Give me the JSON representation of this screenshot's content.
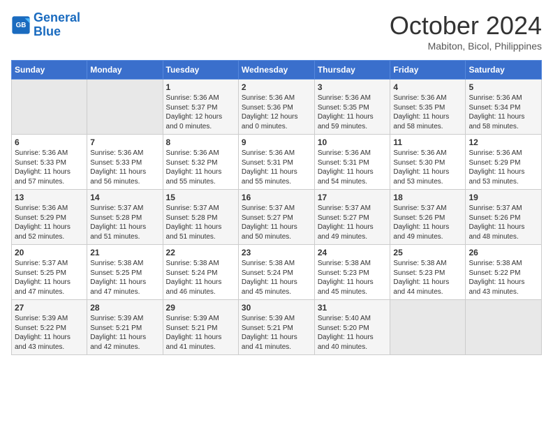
{
  "header": {
    "logo_line1": "General",
    "logo_line2": "Blue",
    "month": "October 2024",
    "location": "Mabiton, Bicol, Philippines"
  },
  "columns": [
    "Sunday",
    "Monday",
    "Tuesday",
    "Wednesday",
    "Thursday",
    "Friday",
    "Saturday"
  ],
  "weeks": [
    [
      {
        "day": "",
        "content": ""
      },
      {
        "day": "",
        "content": ""
      },
      {
        "day": "1",
        "content": "Sunrise: 5:36 AM\nSunset: 5:37 PM\nDaylight: 12 hours\nand 0 minutes."
      },
      {
        "day": "2",
        "content": "Sunrise: 5:36 AM\nSunset: 5:36 PM\nDaylight: 12 hours\nand 0 minutes."
      },
      {
        "day": "3",
        "content": "Sunrise: 5:36 AM\nSunset: 5:35 PM\nDaylight: 11 hours\nand 59 minutes."
      },
      {
        "day": "4",
        "content": "Sunrise: 5:36 AM\nSunset: 5:35 PM\nDaylight: 11 hours\nand 58 minutes."
      },
      {
        "day": "5",
        "content": "Sunrise: 5:36 AM\nSunset: 5:34 PM\nDaylight: 11 hours\nand 58 minutes."
      }
    ],
    [
      {
        "day": "6",
        "content": "Sunrise: 5:36 AM\nSunset: 5:33 PM\nDaylight: 11 hours\nand 57 minutes."
      },
      {
        "day": "7",
        "content": "Sunrise: 5:36 AM\nSunset: 5:33 PM\nDaylight: 11 hours\nand 56 minutes."
      },
      {
        "day": "8",
        "content": "Sunrise: 5:36 AM\nSunset: 5:32 PM\nDaylight: 11 hours\nand 55 minutes."
      },
      {
        "day": "9",
        "content": "Sunrise: 5:36 AM\nSunset: 5:31 PM\nDaylight: 11 hours\nand 55 minutes."
      },
      {
        "day": "10",
        "content": "Sunrise: 5:36 AM\nSunset: 5:31 PM\nDaylight: 11 hours\nand 54 minutes."
      },
      {
        "day": "11",
        "content": "Sunrise: 5:36 AM\nSunset: 5:30 PM\nDaylight: 11 hours\nand 53 minutes."
      },
      {
        "day": "12",
        "content": "Sunrise: 5:36 AM\nSunset: 5:29 PM\nDaylight: 11 hours\nand 53 minutes."
      }
    ],
    [
      {
        "day": "13",
        "content": "Sunrise: 5:36 AM\nSunset: 5:29 PM\nDaylight: 11 hours\nand 52 minutes."
      },
      {
        "day": "14",
        "content": "Sunrise: 5:37 AM\nSunset: 5:28 PM\nDaylight: 11 hours\nand 51 minutes."
      },
      {
        "day": "15",
        "content": "Sunrise: 5:37 AM\nSunset: 5:28 PM\nDaylight: 11 hours\nand 51 minutes."
      },
      {
        "day": "16",
        "content": "Sunrise: 5:37 AM\nSunset: 5:27 PM\nDaylight: 11 hours\nand 50 minutes."
      },
      {
        "day": "17",
        "content": "Sunrise: 5:37 AM\nSunset: 5:27 PM\nDaylight: 11 hours\nand 49 minutes."
      },
      {
        "day": "18",
        "content": "Sunrise: 5:37 AM\nSunset: 5:26 PM\nDaylight: 11 hours\nand 49 minutes."
      },
      {
        "day": "19",
        "content": "Sunrise: 5:37 AM\nSunset: 5:26 PM\nDaylight: 11 hours\nand 48 minutes."
      }
    ],
    [
      {
        "day": "20",
        "content": "Sunrise: 5:37 AM\nSunset: 5:25 PM\nDaylight: 11 hours\nand 47 minutes."
      },
      {
        "day": "21",
        "content": "Sunrise: 5:38 AM\nSunset: 5:25 PM\nDaylight: 11 hours\nand 47 minutes."
      },
      {
        "day": "22",
        "content": "Sunrise: 5:38 AM\nSunset: 5:24 PM\nDaylight: 11 hours\nand 46 minutes."
      },
      {
        "day": "23",
        "content": "Sunrise: 5:38 AM\nSunset: 5:24 PM\nDaylight: 11 hours\nand 45 minutes."
      },
      {
        "day": "24",
        "content": "Sunrise: 5:38 AM\nSunset: 5:23 PM\nDaylight: 11 hours\nand 45 minutes."
      },
      {
        "day": "25",
        "content": "Sunrise: 5:38 AM\nSunset: 5:23 PM\nDaylight: 11 hours\nand 44 minutes."
      },
      {
        "day": "26",
        "content": "Sunrise: 5:38 AM\nSunset: 5:22 PM\nDaylight: 11 hours\nand 43 minutes."
      }
    ],
    [
      {
        "day": "27",
        "content": "Sunrise: 5:39 AM\nSunset: 5:22 PM\nDaylight: 11 hours\nand 43 minutes."
      },
      {
        "day": "28",
        "content": "Sunrise: 5:39 AM\nSunset: 5:21 PM\nDaylight: 11 hours\nand 42 minutes."
      },
      {
        "day": "29",
        "content": "Sunrise: 5:39 AM\nSunset: 5:21 PM\nDaylight: 11 hours\nand 41 minutes."
      },
      {
        "day": "30",
        "content": "Sunrise: 5:39 AM\nSunset: 5:21 PM\nDaylight: 11 hours\nand 41 minutes."
      },
      {
        "day": "31",
        "content": "Sunrise: 5:40 AM\nSunset: 5:20 PM\nDaylight: 11 hours\nand 40 minutes."
      },
      {
        "day": "",
        "content": ""
      },
      {
        "day": "",
        "content": ""
      }
    ]
  ]
}
